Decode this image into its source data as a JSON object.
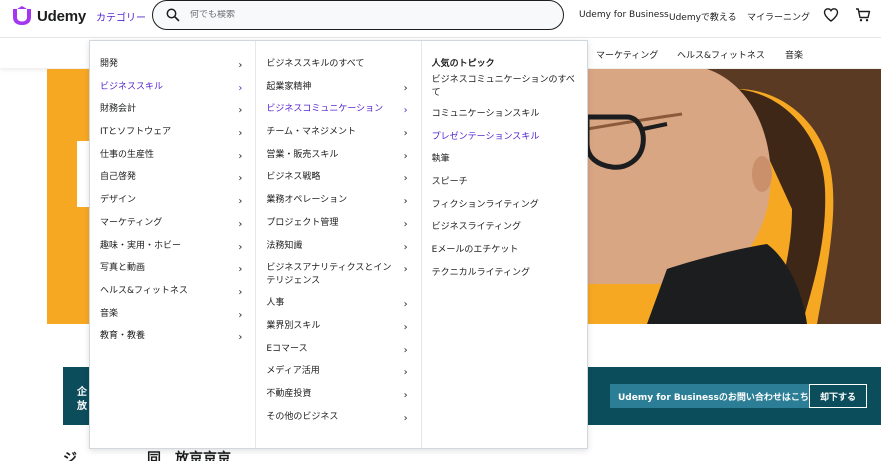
{
  "brand": {
    "logo_text": "Udemy",
    "accent": "#a435f0",
    "link_color": "#5624d0",
    "hero_color": "#f7a823",
    "banner_color": "#0c4d5c"
  },
  "header": {
    "categories_label": "カテゴリー",
    "search_placeholder": "何でも検索",
    "business_link": "Udemy for Business",
    "teach_link": "Udemyで教える",
    "my_learning_link": "マイラーニング",
    "wishlist_icon": "heart-icon",
    "cart_icon": "cart-icon"
  },
  "subnav": [
    "マーケティング",
    "ヘルス&フィットネス",
    "音楽"
  ],
  "menu": {
    "categories": [
      {
        "label": "開発"
      },
      {
        "label": "ビジネススキル"
      },
      {
        "label": "財務会計"
      },
      {
        "label": "ITとソフトウェア"
      },
      {
        "label": "仕事の生産性"
      },
      {
        "label": "自己啓発"
      },
      {
        "label": "デザイン"
      },
      {
        "label": "マーケティング"
      },
      {
        "label": "趣味・実用・ホビー"
      },
      {
        "label": "写真と動画"
      },
      {
        "label": "ヘルス&フィットネス"
      },
      {
        "label": "音楽"
      },
      {
        "label": "教育・教養"
      }
    ],
    "subcategories": [
      {
        "label": "ビジネススキルのすべて"
      },
      {
        "label": "起業家精神"
      },
      {
        "label": "ビジネスコミュニケーション"
      },
      {
        "label": "チーム・マネジメント"
      },
      {
        "label": "営業・販売スキル"
      },
      {
        "label": "ビジネス戦略"
      },
      {
        "label": "業務オペレーション"
      },
      {
        "label": "プロジェクト管理"
      },
      {
        "label": "法務知識"
      },
      {
        "label": "ビジネスアナリティクスとインテリジェンス"
      },
      {
        "label": "人事"
      },
      {
        "label": "業界別スキル"
      },
      {
        "label": "Eコマース"
      },
      {
        "label": "メディア活用"
      },
      {
        "label": "不動産投資"
      },
      {
        "label": "その他のビジネス"
      }
    ],
    "topics_title": "人気のトピック",
    "topics": [
      {
        "label": "ビジネスコミュニケーションのすべて"
      },
      {
        "label": "コミュニケーションスキル"
      },
      {
        "label": "プレゼンテーションスキル"
      },
      {
        "label": "執筆"
      },
      {
        "label": "スピーチ"
      },
      {
        "label": "フィクションライティング"
      },
      {
        "label": "ビジネスライティング"
      },
      {
        "label": "Eメールのエチケット"
      },
      {
        "label": "テクニカルライティング"
      }
    ]
  },
  "banner": {
    "text_line1": "企",
    "text_line2": "放",
    "contact_button": "Udemy for Businessのお問い合わせはこちら",
    "dismiss_button": "却下する"
  },
  "bottom": {
    "title_fragment": "ジ　　　　　同　放京京京"
  }
}
